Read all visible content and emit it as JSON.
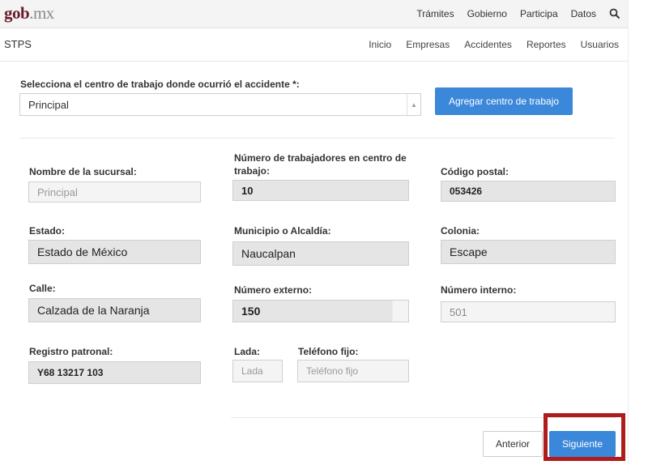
{
  "header": {
    "logo_main": "gob",
    "logo_domain": ".mx",
    "nav": [
      "Trámites",
      "Gobierno",
      "Participa",
      "Datos"
    ],
    "search_icon": "search-icon"
  },
  "subheader": {
    "brand": "STPS",
    "nav": [
      "Inicio",
      "Empresas",
      "Accidentes",
      "Reportes",
      "Usuarios"
    ]
  },
  "form": {
    "select_label": "Selecciona el centro de trabajo donde ocurrió el accidente *:",
    "select_value": "Principal",
    "add_button": "Agregar centro de trabajo",
    "fields": {
      "sucursal": {
        "label": "Nombre de la sucursal:",
        "value": "Principal"
      },
      "trabajadores": {
        "label": "Número de trabajadores en centro de trabajo:",
        "value": "10"
      },
      "cp": {
        "label": "Código postal:",
        "value": "053426"
      },
      "estado": {
        "label": "Estado:",
        "value": "Estado de México"
      },
      "municipio": {
        "label": "Municipio o Alcaldía:",
        "value": "Naucalpan"
      },
      "colonia": {
        "label": "Colonia:",
        "value": "Escape"
      },
      "calle": {
        "label": "Calle:",
        "value": "Calzada de la Naranja"
      },
      "num_ext": {
        "label": "Número externo:",
        "value": "150"
      },
      "num_int": {
        "label": "Número interno:",
        "value": "501"
      },
      "registro": {
        "label": "Registro patronal:",
        "value": "Y68 13217 103"
      },
      "lada": {
        "label": "Lada:",
        "placeholder": "Lada"
      },
      "telefono": {
        "label": "Teléfono fijo:",
        "placeholder": "Teléfono fijo"
      }
    },
    "prev_button": "Anterior",
    "next_button": "Siguiente"
  },
  "colors": {
    "brand": "#6a1b2d",
    "primary": "#3b87d9",
    "highlight": "#b01c1c"
  }
}
